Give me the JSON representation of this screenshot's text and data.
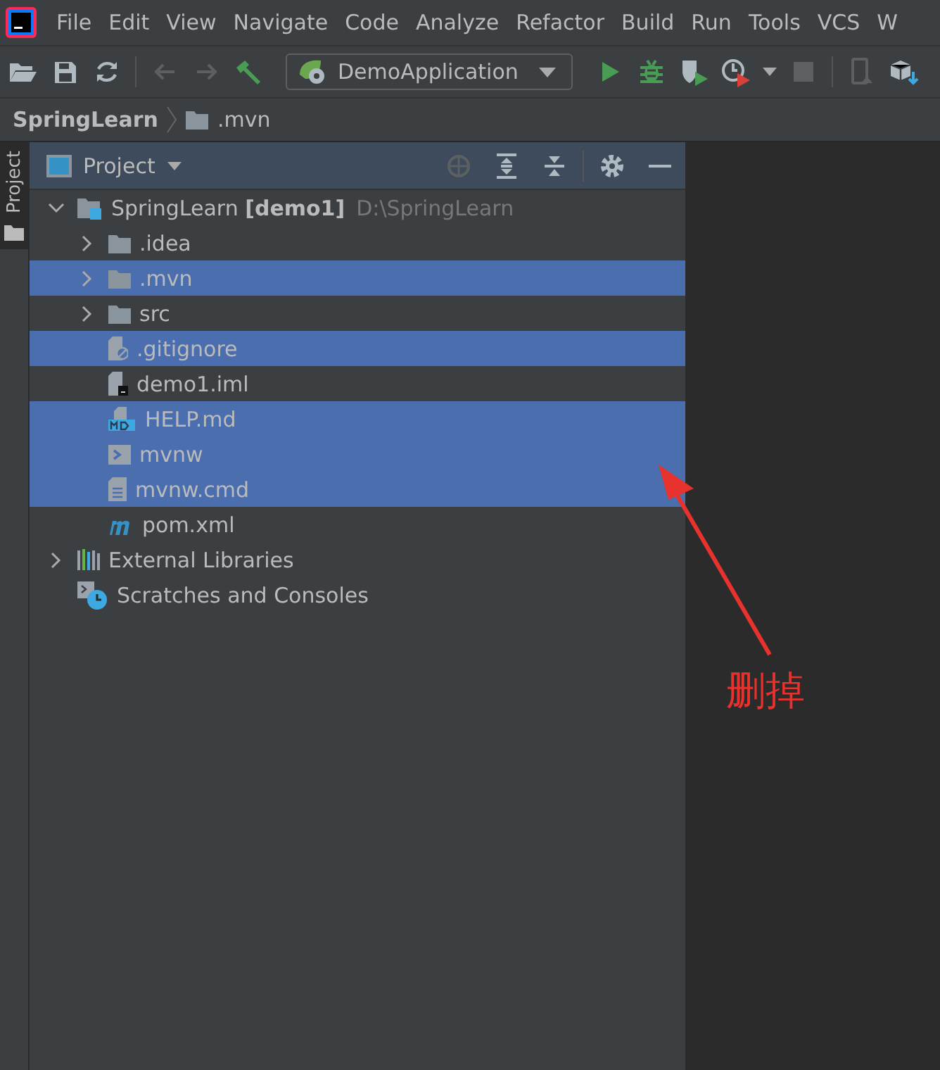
{
  "menu": [
    {
      "label": "File"
    },
    {
      "label": "Edit"
    },
    {
      "label": "View"
    },
    {
      "label": "Navigate"
    },
    {
      "label": "Code"
    },
    {
      "label": "Analyze"
    },
    {
      "label": "Refactor"
    },
    {
      "label": "Build"
    },
    {
      "label": "Run"
    },
    {
      "label": "Tools"
    },
    {
      "label": "VCS"
    },
    {
      "label": "W"
    }
  ],
  "run_config": {
    "label": "DemoApplication"
  },
  "breadcrumb": [
    {
      "label": "SpringLearn",
      "kind": "project"
    },
    {
      "label": ".mvn",
      "kind": "folder"
    }
  ],
  "side_tab": {
    "label": "Project",
    "selected": true
  },
  "panel": {
    "title": "Project"
  },
  "tree": [
    {
      "label": "SpringLearn **[demo1]**",
      "path": "D:\\SpringLearn",
      "kind": "module",
      "expanded": true,
      "selected": false,
      "children": [
        {
          "label": ".idea",
          "kind": "folder",
          "expanded": false,
          "selected": false
        },
        {
          "label": ".mvn",
          "kind": "folder",
          "expanded": false,
          "selected": true
        },
        {
          "label": "src",
          "kind": "folder",
          "expanded": false,
          "selected": false
        },
        {
          "label": ".gitignore",
          "kind": "gitignore",
          "selected": true
        },
        {
          "label": "demo1.iml",
          "kind": "iml",
          "selected": false
        },
        {
          "label": "HELP.md",
          "kind": "markdown",
          "selected": true
        },
        {
          "label": "mvnw",
          "kind": "script",
          "selected": true
        },
        {
          "label": "mvnw.cmd",
          "kind": "text",
          "selected": true
        },
        {
          "label": "pom.xml",
          "kind": "maven",
          "selected": false
        }
      ]
    },
    {
      "label": "External Libraries",
      "kind": "libraries",
      "expanded": false,
      "selected": false
    },
    {
      "label": "Scratches and Consoles",
      "kind": "scratches",
      "selected": false
    }
  ],
  "annotation": {
    "label": "删掉"
  }
}
